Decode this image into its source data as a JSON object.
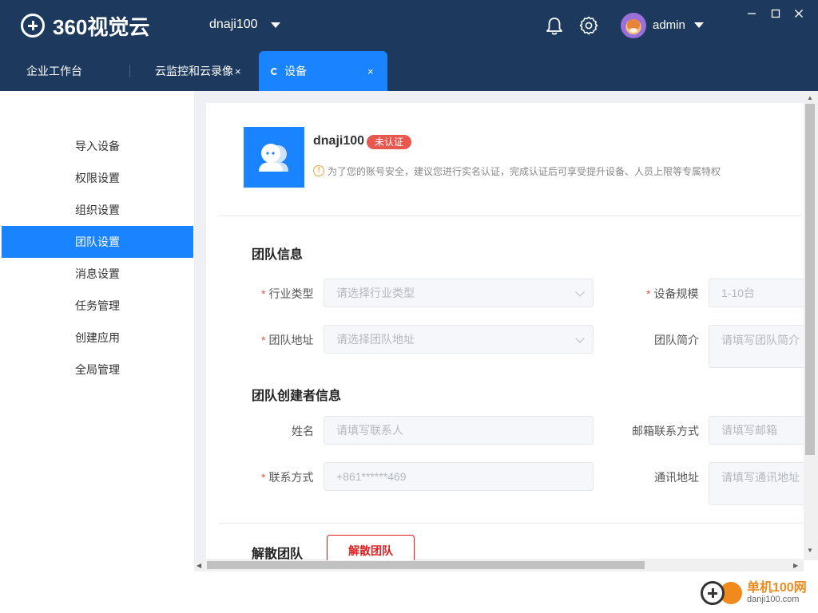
{
  "app": {
    "logo_text": "360视觉云"
  },
  "header": {
    "org_name": "dnaji100",
    "user_name": "admin"
  },
  "tabs": [
    {
      "label": "企业工作台"
    },
    {
      "label": "云监控和云录像",
      "close": "×"
    },
    {
      "label": "设备",
      "close": "×"
    }
  ],
  "sidebar": {
    "items": [
      {
        "label": "导入设备"
      },
      {
        "label": "权限设置"
      },
      {
        "label": "组织设置"
      },
      {
        "label": "团队设置",
        "active": true
      },
      {
        "label": "消息设置"
      },
      {
        "label": "任务管理"
      },
      {
        "label": "创建应用"
      },
      {
        "label": "全局管理"
      }
    ]
  },
  "team": {
    "name": "dnaji100",
    "badge": "未认证",
    "tip": "为了您的账号安全，建议您进行实名认证，完成认证后可享受提升设备、人员上限等专属特权"
  },
  "team_info": {
    "title": "团队信息",
    "industry": {
      "label": "行业类型",
      "placeholder": "请选择行业类型",
      "required": true
    },
    "scale": {
      "label": "设备规模",
      "value": "1-10台",
      "required": true
    },
    "address": {
      "label": "团队地址",
      "placeholder": "请选择团队地址",
      "required": true
    },
    "intro": {
      "label": "团队简介",
      "placeholder": "请填写团队简介"
    }
  },
  "creator_info": {
    "title": "团队创建者信息",
    "name": {
      "label": "姓名",
      "placeholder": "请填写联系人"
    },
    "email": {
      "label": "邮箱联系方式",
      "placeholder": "请填写邮箱"
    },
    "phone": {
      "label": "联系方式",
      "value": "+861******469",
      "required": true
    },
    "mail_address": {
      "label": "通讯地址",
      "placeholder": "请填写通讯地址"
    }
  },
  "dissolve": {
    "title": "解散团队",
    "button": "解散团队"
  },
  "watermark": {
    "site_cn": "单机100网",
    "site_url": "danji100.com"
  },
  "colors": {
    "header_bg": "#1d3a5e",
    "accent": "#1a83ff",
    "danger": "#e02020",
    "badge": "#e8584f"
  }
}
